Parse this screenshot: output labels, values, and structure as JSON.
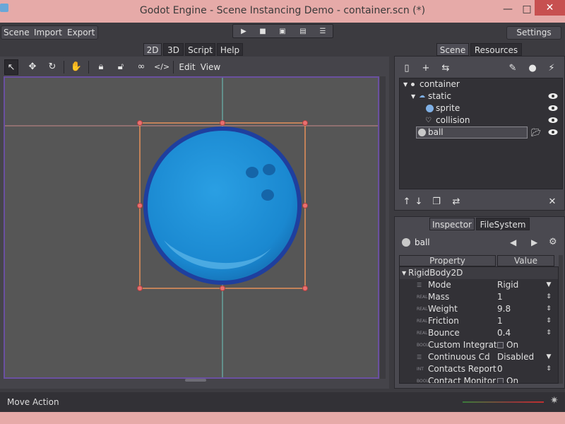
{
  "window": {
    "title": "Godot Engine - Scene Instancing Demo - container.scn (*)",
    "minimize": "—",
    "maximize": "□",
    "close": "✕"
  },
  "menu": {
    "scene": "Scene",
    "import": "Import",
    "export": "Export",
    "settings": "Settings"
  },
  "editor_tabs": [
    {
      "label": "2D",
      "active": true
    },
    {
      "label": "3D"
    },
    {
      "label": "Script"
    },
    {
      "label": "Help"
    }
  ],
  "canvas_menu": {
    "edit": "Edit",
    "view": "View"
  },
  "dock_tabs": {
    "scene": "Scene",
    "resources": "Resources",
    "inspector": "Inspector",
    "filesystem": "FileSystem"
  },
  "scene_tree": [
    {
      "label": "container",
      "icon": "dot-icon",
      "depth": 0,
      "arrow": "▼"
    },
    {
      "label": "static",
      "icon": "static-body-icon",
      "depth": 1,
      "arrow": "▼"
    },
    {
      "label": "sprite",
      "icon": "sprite-icon",
      "depth": 2
    },
    {
      "label": "collision",
      "icon": "collision-shape-icon",
      "depth": 2
    },
    {
      "label": "ball",
      "icon": "rigid-body-icon",
      "depth": 1,
      "selected": true
    }
  ],
  "inspector": {
    "object": "ball",
    "col_property": "Property",
    "col_value": "Value",
    "section": "RigidBody2D",
    "rows": [
      {
        "name": "Mode",
        "value": "Rigid",
        "ctl": "▼"
      },
      {
        "name": "Mass",
        "value": "1",
        "type": "REAL",
        "ctl": "⇕"
      },
      {
        "name": "Weight",
        "value": "9.8",
        "type": "REAL",
        "ctl": "⇕"
      },
      {
        "name": "Friction",
        "value": "1",
        "type": "REAL",
        "ctl": "⇕"
      },
      {
        "name": "Bounce",
        "value": "0.4",
        "type": "REAL",
        "ctl": "⇕"
      },
      {
        "name": "Custom Integrato",
        "value": "On",
        "type": "BOOL",
        "check": true
      },
      {
        "name": "Continuous Cd",
        "value": "Disabled",
        "ctl": "▼"
      },
      {
        "name": "Contacts Reporte",
        "value": "0",
        "type": "INT",
        "ctl": "⇕"
      },
      {
        "name": "Contact Monitor",
        "value": "On",
        "type": "BOOL",
        "check": true
      }
    ]
  },
  "status": {
    "text": "Move Action"
  },
  "colors": {
    "accent": "#6a50a0",
    "titlebar": "#e6aaa8",
    "ball": "#1e8fd6",
    "selection": "#e6905a"
  }
}
